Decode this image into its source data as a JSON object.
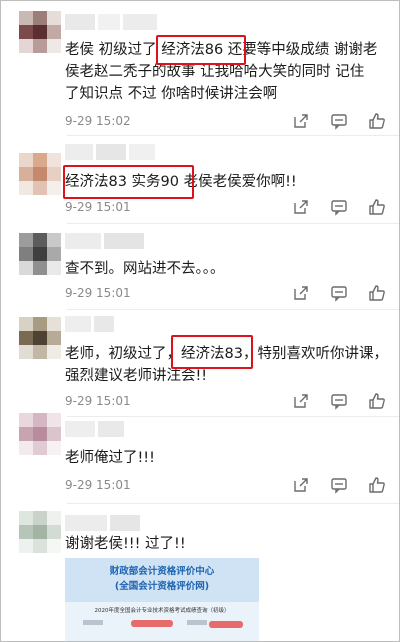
{
  "colors": {
    "highlight": "#d9141e",
    "time": "#8a8a8a",
    "text": "#1a1a1a"
  },
  "icons": [
    "share-icon",
    "reply-icon",
    "like-icon"
  ],
  "comments": [
    {
      "lines": [
        "老侯 初级过了 经济法86 还要等中级成绩 谢谢老",
        "侯老赵二秃子的故事 让我哈哈大笑的同时 记住",
        "了知识点 不过 你啥时候讲注会啊"
      ],
      "time": "9-29 15:02"
    },
    {
      "lines": [
        "经济法83 实务90 老侯老侯爱你啊!!"
      ],
      "time": "9-29 15:01"
    },
    {
      "lines": [
        "查不到。网站进不去。。。"
      ],
      "time": "9-29 15:01"
    },
    {
      "lines": [
        "老师，初级过了，经济法83，特别喜欢听你讲课，",
        "强烈建议老师讲注会!!"
      ],
      "time": "9-29 15:01"
    },
    {
      "lines": [
        "老师俺过了!!!"
      ],
      "time": "9-29 15:01"
    },
    {
      "lines": [
        "谢谢老侯!!! 过了!!"
      ],
      "time": ""
    }
  ],
  "certificate": {
    "org": "财政部会计资格评价中心",
    "site": "(全国会计资格评价网)",
    "heading": "2020年度全国会计专业技术资格考试成绩查询（初级）"
  }
}
